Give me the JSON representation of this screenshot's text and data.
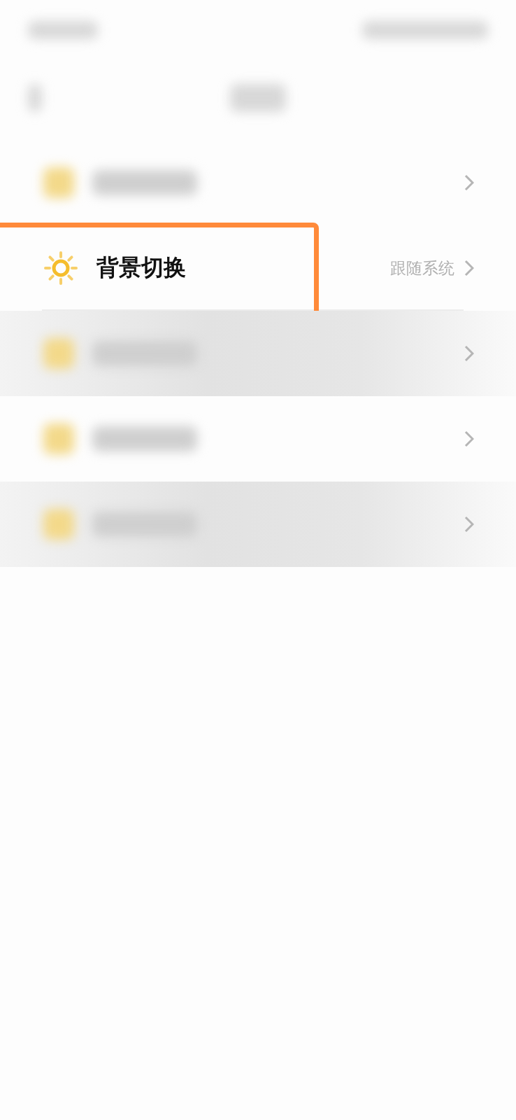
{
  "rows": [
    {
      "kind": "blurred",
      "shaded": false,
      "highlighted": false
    },
    {
      "kind": "clear",
      "label": "背景切换",
      "value": "跟随系统",
      "shaded": false,
      "highlighted": true
    },
    {
      "kind": "blurred",
      "shaded": true,
      "highlighted": false
    },
    {
      "kind": "blurred",
      "shaded": false,
      "highlighted": false
    },
    {
      "kind": "blurred",
      "shaded": true,
      "highlighted": false
    }
  ]
}
